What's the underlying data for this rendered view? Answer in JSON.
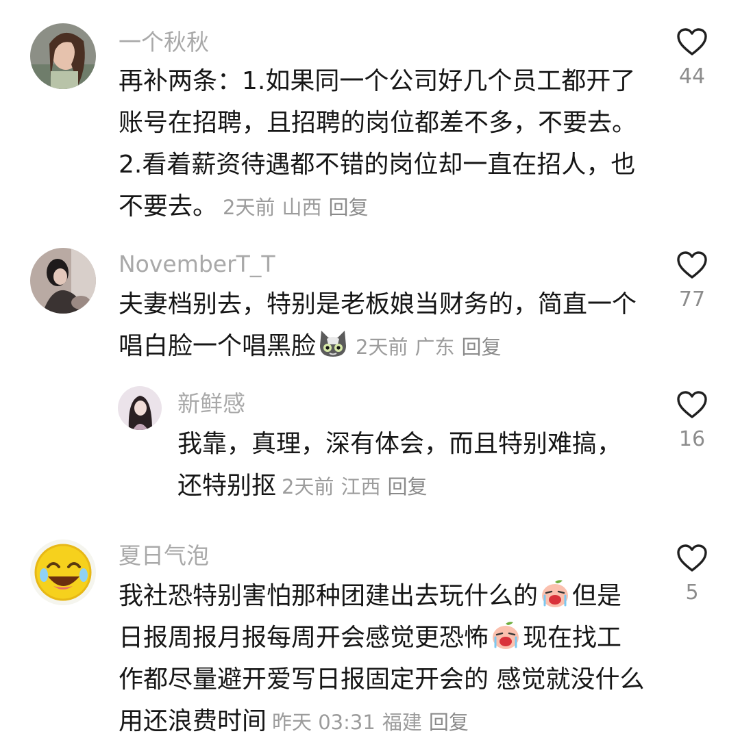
{
  "comments": [
    {
      "username": "一个秋秋",
      "text": "再补两条：1.如果同一个公司好几个员工都开了账号在招聘，且招聘的岗位都差不多，不要去。2.看着薪资待遇都不错的岗位却一直在招人，也不要去。",
      "time": "2天前",
      "location": "山西",
      "reply_label": "回复",
      "likes": "44"
    },
    {
      "username": "NovemberT_T",
      "text": "夫妻档别去，特别是老板娘当财务的，简直一个唱白脸一个唱黑脸",
      "emoji": "cat-face-emoji",
      "time": "2天前",
      "location": "广东",
      "reply_label": "回复",
      "likes": "77",
      "replies": [
        {
          "username": "新鲜感",
          "text": "我靠，真理，深有体会，而且特别难搞，还特别抠",
          "time": "2天前",
          "location": "江西",
          "reply_label": "回复",
          "likes": "16"
        }
      ]
    },
    {
      "username": "夏日气泡",
      "text_part1": "我社恐特别害怕那种团建出去玩什么的",
      "text_part2": "但是日报周报月报每周开会感觉更恐怖",
      "text_part3": "现在找工作都尽量避开爱写日报固定开会的 感觉就没什么用还浪费时间",
      "emoji": "crying-peach-emoji",
      "time": "昨天 03:31",
      "location": "福建",
      "reply_label": "回复",
      "likes": "5"
    }
  ],
  "icons": {
    "like": "heart-outline-icon"
  },
  "colors": {
    "username": "#a9a9a9",
    "text": "#161616",
    "meta": "#9c9c9c"
  }
}
